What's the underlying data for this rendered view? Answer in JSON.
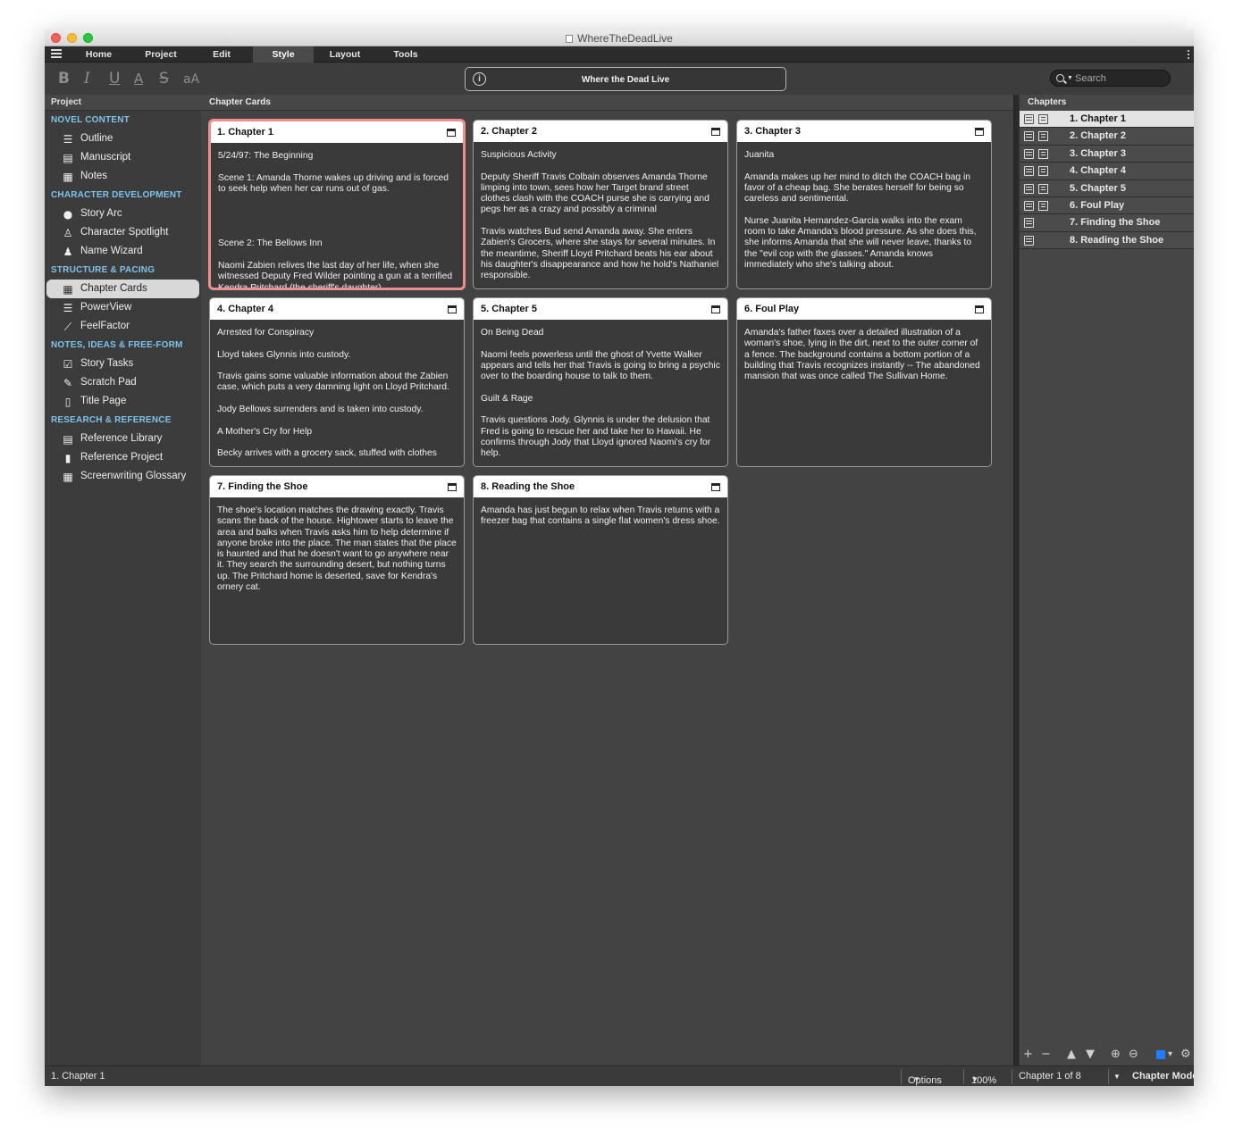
{
  "window": {
    "title": "WhereTheDeadLive"
  },
  "menu": {
    "tabs": [
      {
        "label": "Home"
      },
      {
        "label": "Project"
      },
      {
        "label": "Edit"
      },
      {
        "label": "Style",
        "active": true
      },
      {
        "label": "Layout"
      },
      {
        "label": "Tools"
      }
    ]
  },
  "toolbar": {
    "bold": "B",
    "italic": "I",
    "underline": "U",
    "text_color": "A",
    "strike": "S",
    "case": "aA",
    "doc_title": "Where the Dead Live",
    "search_placeholder": "Search"
  },
  "sidebar": {
    "header": "Project",
    "sections": [
      {
        "title": "NOVEL CONTENT",
        "items": [
          {
            "label": "Outline",
            "icon": "list-icon"
          },
          {
            "label": "Manuscript",
            "icon": "document-icon"
          },
          {
            "label": "Notes",
            "icon": "notes-icon"
          }
        ]
      },
      {
        "title": "CHARACTER DEVELOPMENT",
        "items": [
          {
            "label": "Story Arc",
            "icon": "person-icon"
          },
          {
            "label": "Character Spotlight",
            "icon": "spotlight-icon"
          },
          {
            "label": "Name Wizard",
            "icon": "wizard-icon"
          }
        ]
      },
      {
        "title": "STRUCTURE & PACING",
        "items": [
          {
            "label": "Chapter Cards",
            "icon": "grid-icon",
            "active": true
          },
          {
            "label": "PowerView",
            "icon": "rows-icon"
          },
          {
            "label": "FeelFactor",
            "icon": "chart-icon"
          }
        ]
      },
      {
        "title": "NOTES, IDEAS & FREE-FORM",
        "items": [
          {
            "label": "Story Tasks",
            "icon": "checkbox-icon"
          },
          {
            "label": "Scratch Pad",
            "icon": "edit-icon"
          },
          {
            "label": "Title Page",
            "icon": "title-page-icon"
          }
        ]
      },
      {
        "title": "RESEARCH & REFERENCE",
        "items": [
          {
            "label": "Reference Library",
            "icon": "library-icon"
          },
          {
            "label": "Reference Project",
            "icon": "bookmark-icon"
          },
          {
            "label": "Screenwriting Glossary",
            "icon": "film-icon"
          }
        ]
      }
    ]
  },
  "main": {
    "header": "Chapter Cards",
    "cards": [
      {
        "title": "1. Chapter 1",
        "selected": true,
        "body": "5/24/97: The Beginning\n\nScene 1: Amanda Thorne wakes up driving and is forced to seek help when her car runs out of gas.\n\n\n\n\nScene 2: The Bellows Inn\n\nNaomi Zabien relives the last day of her life, when she witnessed Deputy Fred Wilder pointing a gun at a terrified Kendra Pritchard (the sheriff's daughter)."
      },
      {
        "title": "2. Chapter 2",
        "body": "Suspicious Activity\n\nDeputy Sheriff Travis Colbain observes Amanda Thorne limping into town, sees how her Target brand street clothes clash with the COACH purse she is carrying and pegs her as a crazy and possibly a criminal\n\nTravis watches Bud send Amanda away. She enters Zabien's Grocers, where she stays for several minutes. In the meantime, Sheriff Lloyd Pritchard beats his ear about his daughter's disappearance and how he hold's Nathaniel responsible."
      },
      {
        "title": "3. Chapter 3",
        "body": "Juanita\n\nAmanda makes up her mind to ditch the COACH bag in favor of a cheap bag. She berates herself for being so careless and sentimental.\n\nNurse Juanita Hernandez-Garcia walks into the exam room to take Amanda's blood pressure. As she does this, she informs Amanda that she will never leave, thanks to the \"evil cop with the glasses.\" Amanda knows immediately who she's talking about."
      },
      {
        "title": "4. Chapter 4",
        "body": "Arrested for Conspiracy\n\nLloyd takes Glynnis into custody.\n\nTravis gains some valuable information about the Zabien case, which puts a very damning light on Lloyd Pritchard.\n\nJody Bellows surrenders and is taken into custody.\n\nA Mother's Cry for Help\n\nBecky arrives with a grocery sack, stuffed with clothes"
      },
      {
        "title": "5. Chapter 5",
        "body": "On Being Dead\n\nNaomi feels powerless until the ghost of Yvette Walker appears and tells her that Travis is going to bring a psychic over to the boarding house to talk to them.\n\nGuilt & Rage\n\nTravis questions Jody. Glynnis is under the delusion that Fred is going to rescue her and take her to Hawaii. He confirms through Jody that Lloyd ignored Naomi's cry for help."
      },
      {
        "title": "6. Foul Play",
        "body": "Amanda's father faxes over a detailed illustration of a woman's shoe, lying in the dirt, next to the outer corner of a fence. The background contains a bottom portion of a building that Travis recognizes instantly -- The abandoned mansion that was once called The Sullivan Home."
      },
      {
        "title": "7. Finding the Shoe",
        "body": "The shoe's location matches the drawing exactly. Travis scans the back of the house. Hightower starts to leave the area and balks when Travis asks him to help determine if anyone broke into the place. The man states that the place is haunted and that he doesn't want to go anywhere near it. They search the surrounding desert, but nothing turns up. The Pritchard home is deserted, save for Kendra's ornery cat."
      },
      {
        "title": "8. Reading the Shoe",
        "body": "Amanda has just begun to relax when Travis returns with a freezer bag that contains a single flat women's dress shoe."
      }
    ]
  },
  "chapters_panel": {
    "header": "Chapters",
    "items": [
      {
        "label": "1.  Chapter 1",
        "selected": true,
        "has_doc": true
      },
      {
        "label": "2.  Chapter 2",
        "has_doc": true
      },
      {
        "label": "3.  Chapter 3",
        "has_doc": true
      },
      {
        "label": "4.  Chapter 4",
        "has_doc": true
      },
      {
        "label": "5.  Chapter 5",
        "has_doc": true
      },
      {
        "label": "6.  Foul Play",
        "has_doc": true
      },
      {
        "label": "7.  Finding the Shoe",
        "has_doc": false
      },
      {
        "label": "8.  Reading the Shoe",
        "has_doc": false
      }
    ],
    "tools": [
      "+",
      "−",
      "▲",
      "▼",
      "⊕",
      "⊖",
      "▾",
      "⚙"
    ]
  },
  "status": {
    "current": "1.  Chapter 1",
    "options": "Options",
    "zoom": "100%",
    "position": "Chapter 1 of 8",
    "mode": "Chapter Mode"
  },
  "colors": {
    "accent": "#7dc4ec",
    "selection_border": "#ee8e8e",
    "color_swatch": "#1e7cff"
  }
}
